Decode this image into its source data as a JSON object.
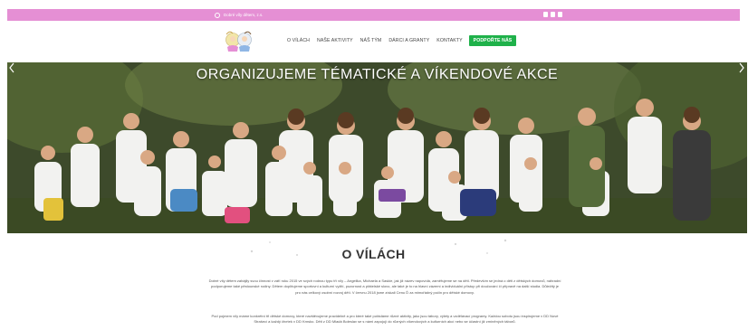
{
  "topbar": {
    "org_name": "Dobré víly dětem, z.s."
  },
  "header": {
    "logo_alt": "logo",
    "nav": {
      "item_1": "O VÍLÁCH",
      "item_2": "NAŠE AKTIVITY",
      "item_3": "NÁŠ TÝM",
      "item_4": "DÁRCI A GRANTY",
      "item_5": "KONTAKTY",
      "cta": "PODPOŘTE NÁS"
    }
  },
  "hero": {
    "title": "ORGANIZUJEME TÉMATICKÉ A VÍKENDOVÉ AKCE"
  },
  "content": {
    "title": "O VÍLÁCH",
    "para1": "Dobré víly dětem zahájily svou činnost v září roku 2015 ve svých rodnou typu tří víly – Angelika, Michaela a Saskie, jak již název napovídá, zaměřujeme se na děti. Především se jedná o děti z dětských domovů, náhradní podporujeme také pěstounské rodiny. Dětem doplňujeme sportovní a kulturní vyžití, pozornost a přátelské slovo, ale také je to na hlavní zázemí a individuální přístup při doučování či přípravě na další studia. Důležitý je pro nás celkový osobní rozvoj dětí. V červnu 2018 jsme získali Cenu Ď za mimořádný počin pro dětské domovy.",
    "para2": "Pod pojmem víly máme konkrétní tři dětské domovy, které navštěvujeme pravidelně a pro které také pořádáme různé aktivity, jako jsou tábory, výlety a vzdělávací programy. Každou sobotu jsou inspirujeme v DD Nové Strašecí a každý čtvrtek v DD Krnsko. Děti z DD Mladá Boleslav se s námi zapojují do různých víkendových a kulturních akcí nebo se účastní již zmíněných táborů."
  },
  "colors": {
    "topbar": "#e58fd4",
    "cta": "#1fb14a",
    "title_text": "#333333"
  },
  "icons": [
    "org-logo-icon",
    "facebook-icon",
    "instagram-icon",
    "youtube-icon",
    "arrow-left-icon",
    "arrow-right-icon"
  ]
}
